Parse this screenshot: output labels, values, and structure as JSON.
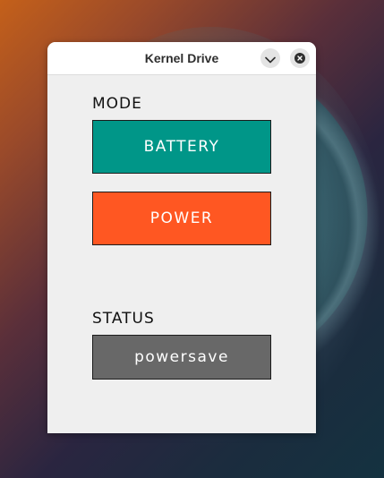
{
  "window": {
    "title": "Kernel Drive"
  },
  "titlebar_buttons": {
    "menu_icon": "chevron-down-icon",
    "close_icon": "close-icon"
  },
  "mode": {
    "label": "MODE",
    "options": [
      {
        "label": "BATTERY",
        "color": "#009688"
      },
      {
        "label": "POWER",
        "color": "#ff5722"
      }
    ]
  },
  "status": {
    "label": "STATUS",
    "value": "powersave",
    "color": "#686868"
  }
}
